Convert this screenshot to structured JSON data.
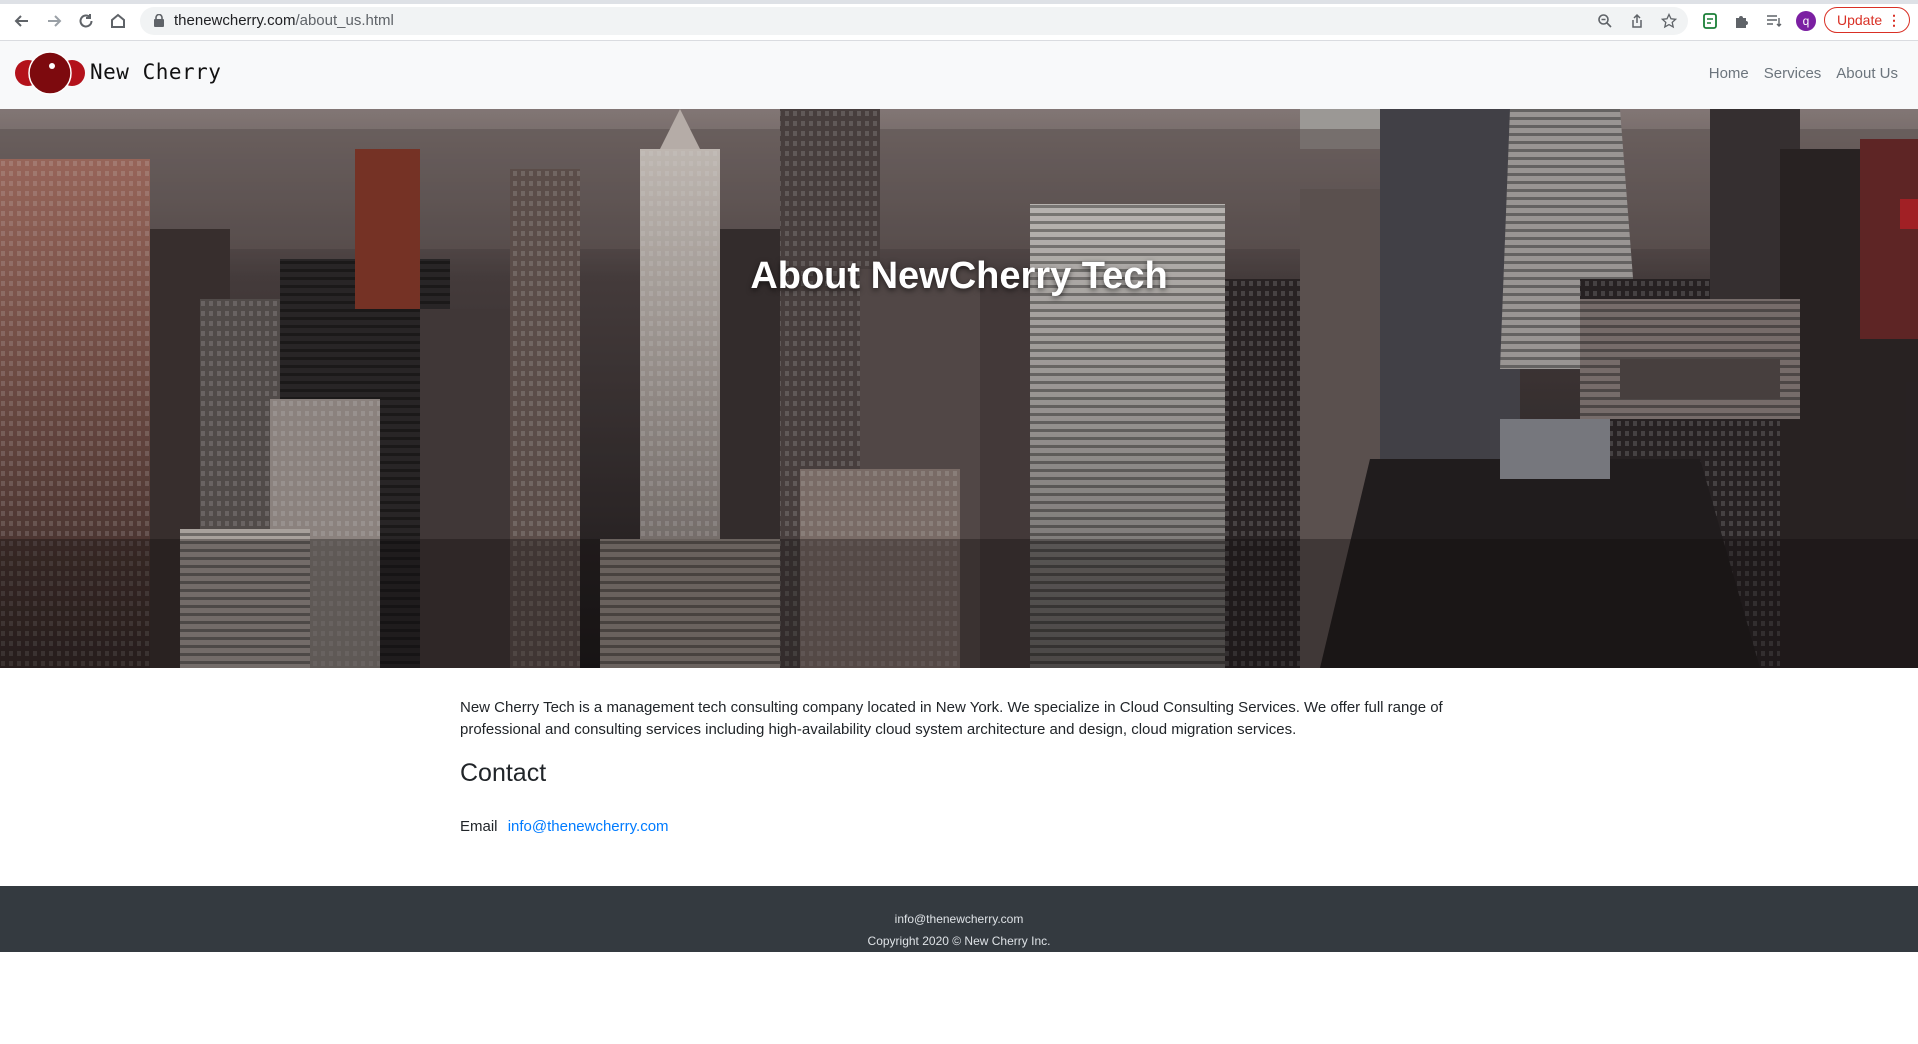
{
  "browser": {
    "url_host": "thenewcherry.com",
    "url_path": "/about_us.html",
    "profile_initial": "q",
    "update_label": "Update"
  },
  "navbar": {
    "brand": "New Cherry",
    "links": [
      "Home",
      "Services",
      "About Us"
    ]
  },
  "hero": {
    "title": "About NewCherry Tech"
  },
  "main": {
    "paragraph": "New Cherry Tech is a management tech consulting company located in New York. We specialize in Cloud Consulting Services. We offer full range of professional and consulting services including high-availability cloud system architecture and design, cloud migration services.",
    "contact_heading": "Contact",
    "email_label": "Email",
    "email_value": "info@thenewcherry.com"
  },
  "footer": {
    "email": "info@thenewcherry.com",
    "copyright": "Copyright 2020 © New Cherry Inc."
  },
  "colors": {
    "brand_red": "#8e0a0a",
    "link_blue": "#007bff",
    "footer_bg": "#343a40",
    "update_red": "#d93025"
  }
}
